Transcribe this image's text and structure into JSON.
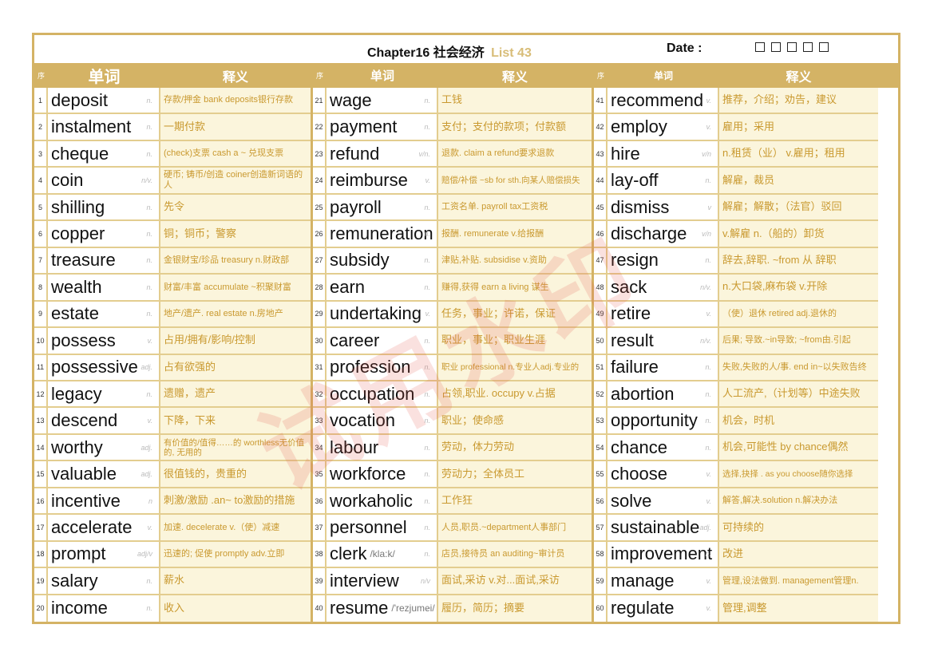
{
  "header": {
    "chapter": "Chapter16 社会经济",
    "list": "List 43",
    "date_label": "Date :",
    "date_boxes": 5
  },
  "columns_header": {
    "seq": "序",
    "word": "单词",
    "definition": "释义"
  },
  "watermark": "试用水印",
  "colors": {
    "border": "#d4b365",
    "definition_text": "#c9992f",
    "definition_bg": "#fbf5dc",
    "list_label": "#d8bd78",
    "watermark": "#e15a50"
  },
  "entries": [
    {
      "n": "1",
      "word": "deposit",
      "pos": "n.",
      "def": "存款/押金 bank deposits银行存款"
    },
    {
      "n": "2",
      "word": "instalment",
      "pos": "n.",
      "def": "一期付款"
    },
    {
      "n": "3",
      "word": "cheque",
      "pos": "n.",
      "def": "(check)支票 cash a ~ 兑现支票"
    },
    {
      "n": "4",
      "word": "coin",
      "pos": "n/v.",
      "def": "硬币; 铸币/创造 coiner创造新词语的人"
    },
    {
      "n": "5",
      "word": "shilling",
      "pos": "n.",
      "def": "先令"
    },
    {
      "n": "6",
      "word": "copper",
      "pos": "n.",
      "def": "铜；铜币；警察"
    },
    {
      "n": "7",
      "word": "treasure",
      "pos": "n.",
      "def": "金银财宝/珍品  treasury n.财政部"
    },
    {
      "n": "8",
      "word": "wealth",
      "pos": "n.",
      "def": "财富/丰富 accumulate ~积聚财富"
    },
    {
      "n": "9",
      "word": "estate",
      "pos": "n.",
      "def": "地产/遗产. real estate n.房地产"
    },
    {
      "n": "10",
      "word": "possess",
      "pos": "v.",
      "def": "占用/拥有/影响/控制"
    },
    {
      "n": "11",
      "word": "possessive",
      "pos": "adj.",
      "def": "占有欲强的"
    },
    {
      "n": "12",
      "word": "legacy",
      "pos": "n.",
      "def": "遗赠，遗产"
    },
    {
      "n": "13",
      "word": "descend",
      "pos": "v.",
      "def": "下降，下来"
    },
    {
      "n": "14",
      "word": "worthy",
      "pos": "adj.",
      "def": "有价值的/值得……的 worthless无价值的, 无用的"
    },
    {
      "n": "15",
      "word": "valuable",
      "pos": "adj.",
      "def": "很值钱的，贵重的"
    },
    {
      "n": "16",
      "word": "incentive",
      "pos": "n",
      "def": "刺激/激励 .an~ to激励的措施"
    },
    {
      "n": "17",
      "word": "accelerate",
      "pos": "v.",
      "def": "加速. decelerate v.（使）减速"
    },
    {
      "n": "18",
      "word": "prompt",
      "pos": "adj/v",
      "def": "迅速的; 促使 promptly adv.立即"
    },
    {
      "n": "19",
      "word": "salary",
      "pos": "n.",
      "def": "薪水"
    },
    {
      "n": "20",
      "word": "income",
      "pos": "n.",
      "def": "收入"
    },
    {
      "n": "21",
      "word": "wage",
      "pos": "n.",
      "def": "工钱"
    },
    {
      "n": "22",
      "word": "payment",
      "pos": "n.",
      "def": "支付；支付的款项；付款额"
    },
    {
      "n": "23",
      "word": "refund",
      "pos": "v/n.",
      "def": "退款. claim a refund要求退款"
    },
    {
      "n": "24",
      "word": "reimburse",
      "pos": "v.",
      "def": "赔偿/补偿 ~sb for sth.向某人赔偿损失"
    },
    {
      "n": "25",
      "word": "payroll",
      "pos": "n.",
      "def": "工资名单. payroll tax工资税"
    },
    {
      "n": "26",
      "word": "remuneration",
      "pos": "n.",
      "def": "报酬. remunerate v.给报酬"
    },
    {
      "n": "27",
      "word": "subsidy",
      "pos": "n.",
      "def": "津贴,补贴. subsidise v.资助"
    },
    {
      "n": "28",
      "word": "earn",
      "pos": "n.",
      "def": "赚得,获得 earn a living 谋生"
    },
    {
      "n": "29",
      "word": "undertaking",
      "pos": "v.",
      "def": "任务，事业；许诺，保证"
    },
    {
      "n": "30",
      "word": "career",
      "pos": "n.",
      "def": "职业，事业；职业生涯"
    },
    {
      "n": "31",
      "word": "profession",
      "pos": "n.",
      "def": "职业 professional n.专业人adj.专业的"
    },
    {
      "n": "32",
      "word": "occupation",
      "pos": "n.",
      "def": "占领,职业. occupy v.占据"
    },
    {
      "n": "33",
      "word": "vocation",
      "pos": "n.",
      "def": "职业；使命感"
    },
    {
      "n": "34",
      "word": "labour",
      "pos": "n.",
      "def": "劳动，体力劳动"
    },
    {
      "n": "35",
      "word": "workforce",
      "pos": "n.",
      "def": "劳动力；全体员工"
    },
    {
      "n": "36",
      "word": "workaholic",
      "pos": "n.",
      "def": "工作狂"
    },
    {
      "n": "37",
      "word": "personnel",
      "pos": "n.",
      "def": "人员,职员.~department人事部门"
    },
    {
      "n": "38",
      "word": "clerk",
      "phonetic": "/kla:k/",
      "pos": "n.",
      "def": "店员,接待员 an auditing~审计员"
    },
    {
      "n": "39",
      "word": "interview",
      "pos": "n/v",
      "def": "面试,采访  v.对...面试,采访"
    },
    {
      "n": "40",
      "word": "resume",
      "phonetic": "/'rezjumei/",
      "pos": "v.",
      "def": "履历，简历；摘要"
    },
    {
      "n": "41",
      "word": "recommend",
      "pos": "v.",
      "def": "推荐，介绍；劝告，建议"
    },
    {
      "n": "42",
      "word": "employ",
      "pos": "v.",
      "def": "雇用；采用"
    },
    {
      "n": "43",
      "word": "hire",
      "pos": "v/n",
      "def": "n.租赁（业） v.雇用；租用"
    },
    {
      "n": "44",
      "word": "lay-off",
      "pos": "n.",
      "def": "解雇，裁员"
    },
    {
      "n": "45",
      "word": "dismiss",
      "pos": "v",
      "def": "解雇；解散；（法官）驳回"
    },
    {
      "n": "46",
      "word": "discharge",
      "pos": "v/n",
      "def": "v.解雇  n.（船的）卸货"
    },
    {
      "n": "47",
      "word": "resign",
      "pos": "n.",
      "def": "辞去,辞职.  ~from 从 辞职"
    },
    {
      "n": "48",
      "word": "sack",
      "pos": "n/v.",
      "def": "n.大口袋,麻布袋 v.开除"
    },
    {
      "n": "49",
      "word": "retire",
      "pos": "v.",
      "def": "（使）退休 retired adj.退休的"
    },
    {
      "n": "50",
      "word": "result",
      "pos": "n/v.",
      "def": "后果; 导致.~in导致; ~from由.引起"
    },
    {
      "n": "51",
      "word": "failure",
      "pos": "n.",
      "def": "失败,失败的人/事. end in~以失败告终"
    },
    {
      "n": "52",
      "word": "abortion",
      "pos": "n.",
      "def": "人工流产,（计划等）中途失败"
    },
    {
      "n": "53",
      "word": "opportunity",
      "pos": "n.",
      "def": "机会，时机"
    },
    {
      "n": "54",
      "word": "chance",
      "pos": "n.",
      "def": "机会,可能性 by chance偶然"
    },
    {
      "n": "55",
      "word": "choose",
      "pos": "v.",
      "def": "选择,抉择 . as you choose随你选择"
    },
    {
      "n": "56",
      "word": "solve",
      "pos": "v.",
      "def": "解答,解决.solution n.解决办法"
    },
    {
      "n": "57",
      "word": "sustainable",
      "pos": "adj.",
      "def": "可持续的"
    },
    {
      "n": "58",
      "word": "improvement",
      "pos": "n.",
      "def": "改进"
    },
    {
      "n": "59",
      "word": "manage",
      "pos": "v.",
      "def": "管理,设法做到. management管理n."
    },
    {
      "n": "60",
      "word": "regulate",
      "pos": "v.",
      "def": "管理,调整"
    }
  ]
}
